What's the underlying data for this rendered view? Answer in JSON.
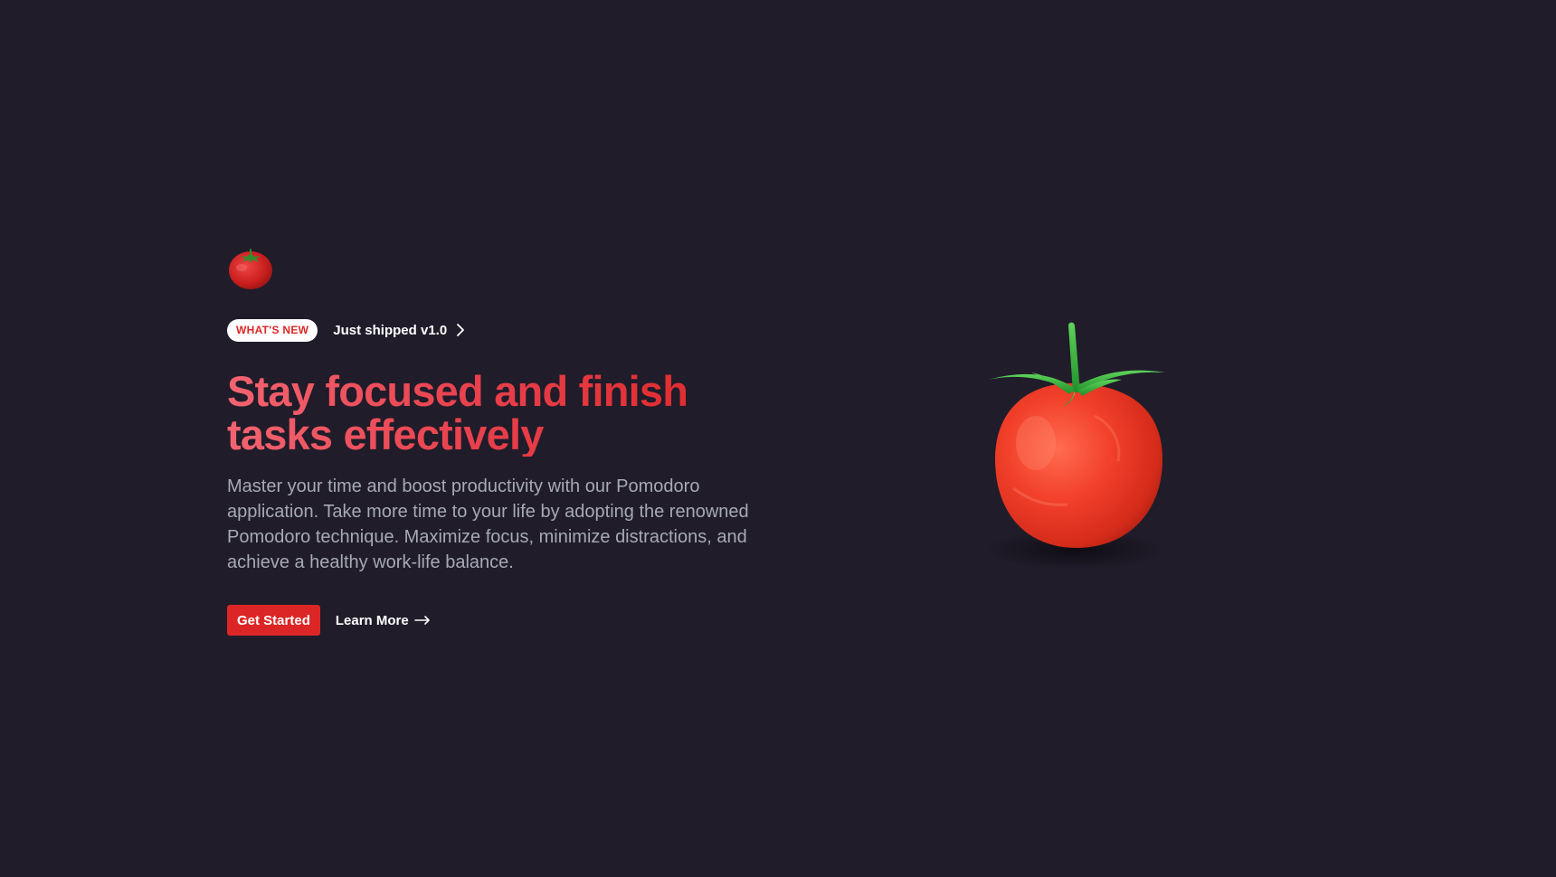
{
  "hero": {
    "logo_icon": "tomato-icon",
    "badge": "WHAT'S NEW",
    "shipped_link": "Just shipped v1.0",
    "headline": "Stay focused and finish tasks effectively",
    "description": "Master your time and boost productivity with our Pomodoro application. Take more time to your life by adopting the renowned Pomodoro technique. Maximize focus, minimize distractions, and achieve a healthy work-life balance.",
    "primary_cta": "Get Started",
    "secondary_cta": "Learn More"
  },
  "colors": {
    "background": "#201c2a",
    "accent": "#dc2626",
    "headline_start": "#f26470",
    "body_text": "#a6a9b6"
  }
}
